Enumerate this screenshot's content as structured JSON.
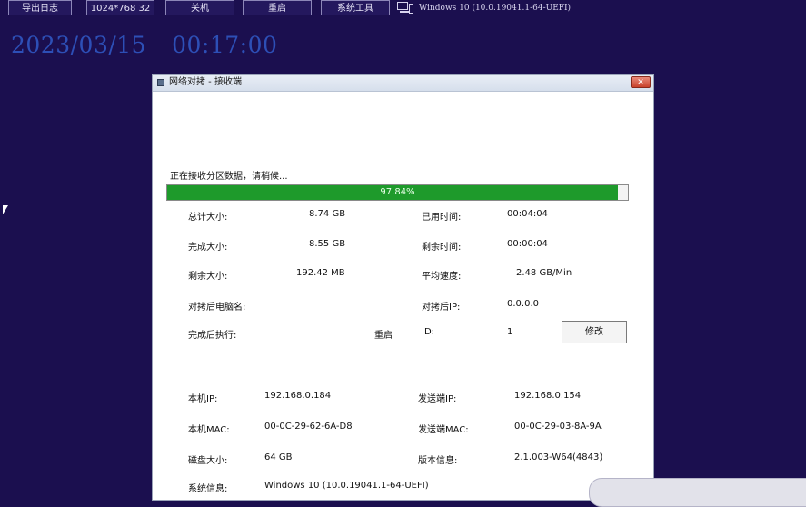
{
  "toolbar": {
    "buttons": [
      "导出日志",
      "1024*768 32",
      "关机",
      "重启",
      "系统工具"
    ],
    "system_label": "Windows 10 (10.0.19041.1-64-UEFI)"
  },
  "datetime": {
    "date": "2023/03/15",
    "time": "00:17:00"
  },
  "dialog": {
    "title": "网络对拷 - 接收端",
    "close_glyph": "✕",
    "status_text": "正在接收分区数据，请稍候...",
    "progress": {
      "value": 0.9784,
      "label": "97.84%"
    },
    "stats": {
      "total_size_label": "总计大小:",
      "total_size": "8.74 GB",
      "done_size_label": "完成大小:",
      "done_size": "8.55 GB",
      "remaining_size_label": "剩余大小:",
      "remaining_size": "192.42 MB",
      "elapsed_label": "已用时间:",
      "elapsed": "00:04:04",
      "remaining_time_label": "剩余时间:",
      "remaining_time": "00:00:04",
      "avg_speed_label": "平均速度:",
      "avg_speed": "2.48 GB/Min",
      "peer_pc_name_label": "对拷后电脑名:",
      "peer_ip_label": "对拷后IP:",
      "peer_ip": "0.0.0.0",
      "after_action_label": "完成后执行:",
      "after_action": "重启",
      "id_label": "ID:",
      "id": "1",
      "modify_button": "修改"
    },
    "info": {
      "local_ip_label": "本机IP:",
      "local_ip": "192.168.0.184",
      "sender_ip_label": "发送端IP:",
      "sender_ip": "192.168.0.154",
      "local_mac_label": "本机MAC:",
      "local_mac": "00-0C-29-62-6A-D8",
      "sender_mac_label": "发送端MAC:",
      "sender_mac": "00-0C-29-03-8A-9A",
      "disk_size_label": "磁盘大小:",
      "disk_size": "64 GB",
      "version_label": "版本信息:",
      "version": "2.1.003-W64(4843)",
      "system_info_label": "系统信息:",
      "system_info": "Windows 10 (10.0.19041.1-64-UEFI)"
    }
  },
  "colors": {
    "background": "#1b0f4f",
    "accent_date": "#2d4fb6",
    "progress_fill": "#1e9a2b"
  },
  "icons": [
    "computer-icon",
    "close-icon",
    "window-icon",
    "mouse-pointer-icon"
  ]
}
